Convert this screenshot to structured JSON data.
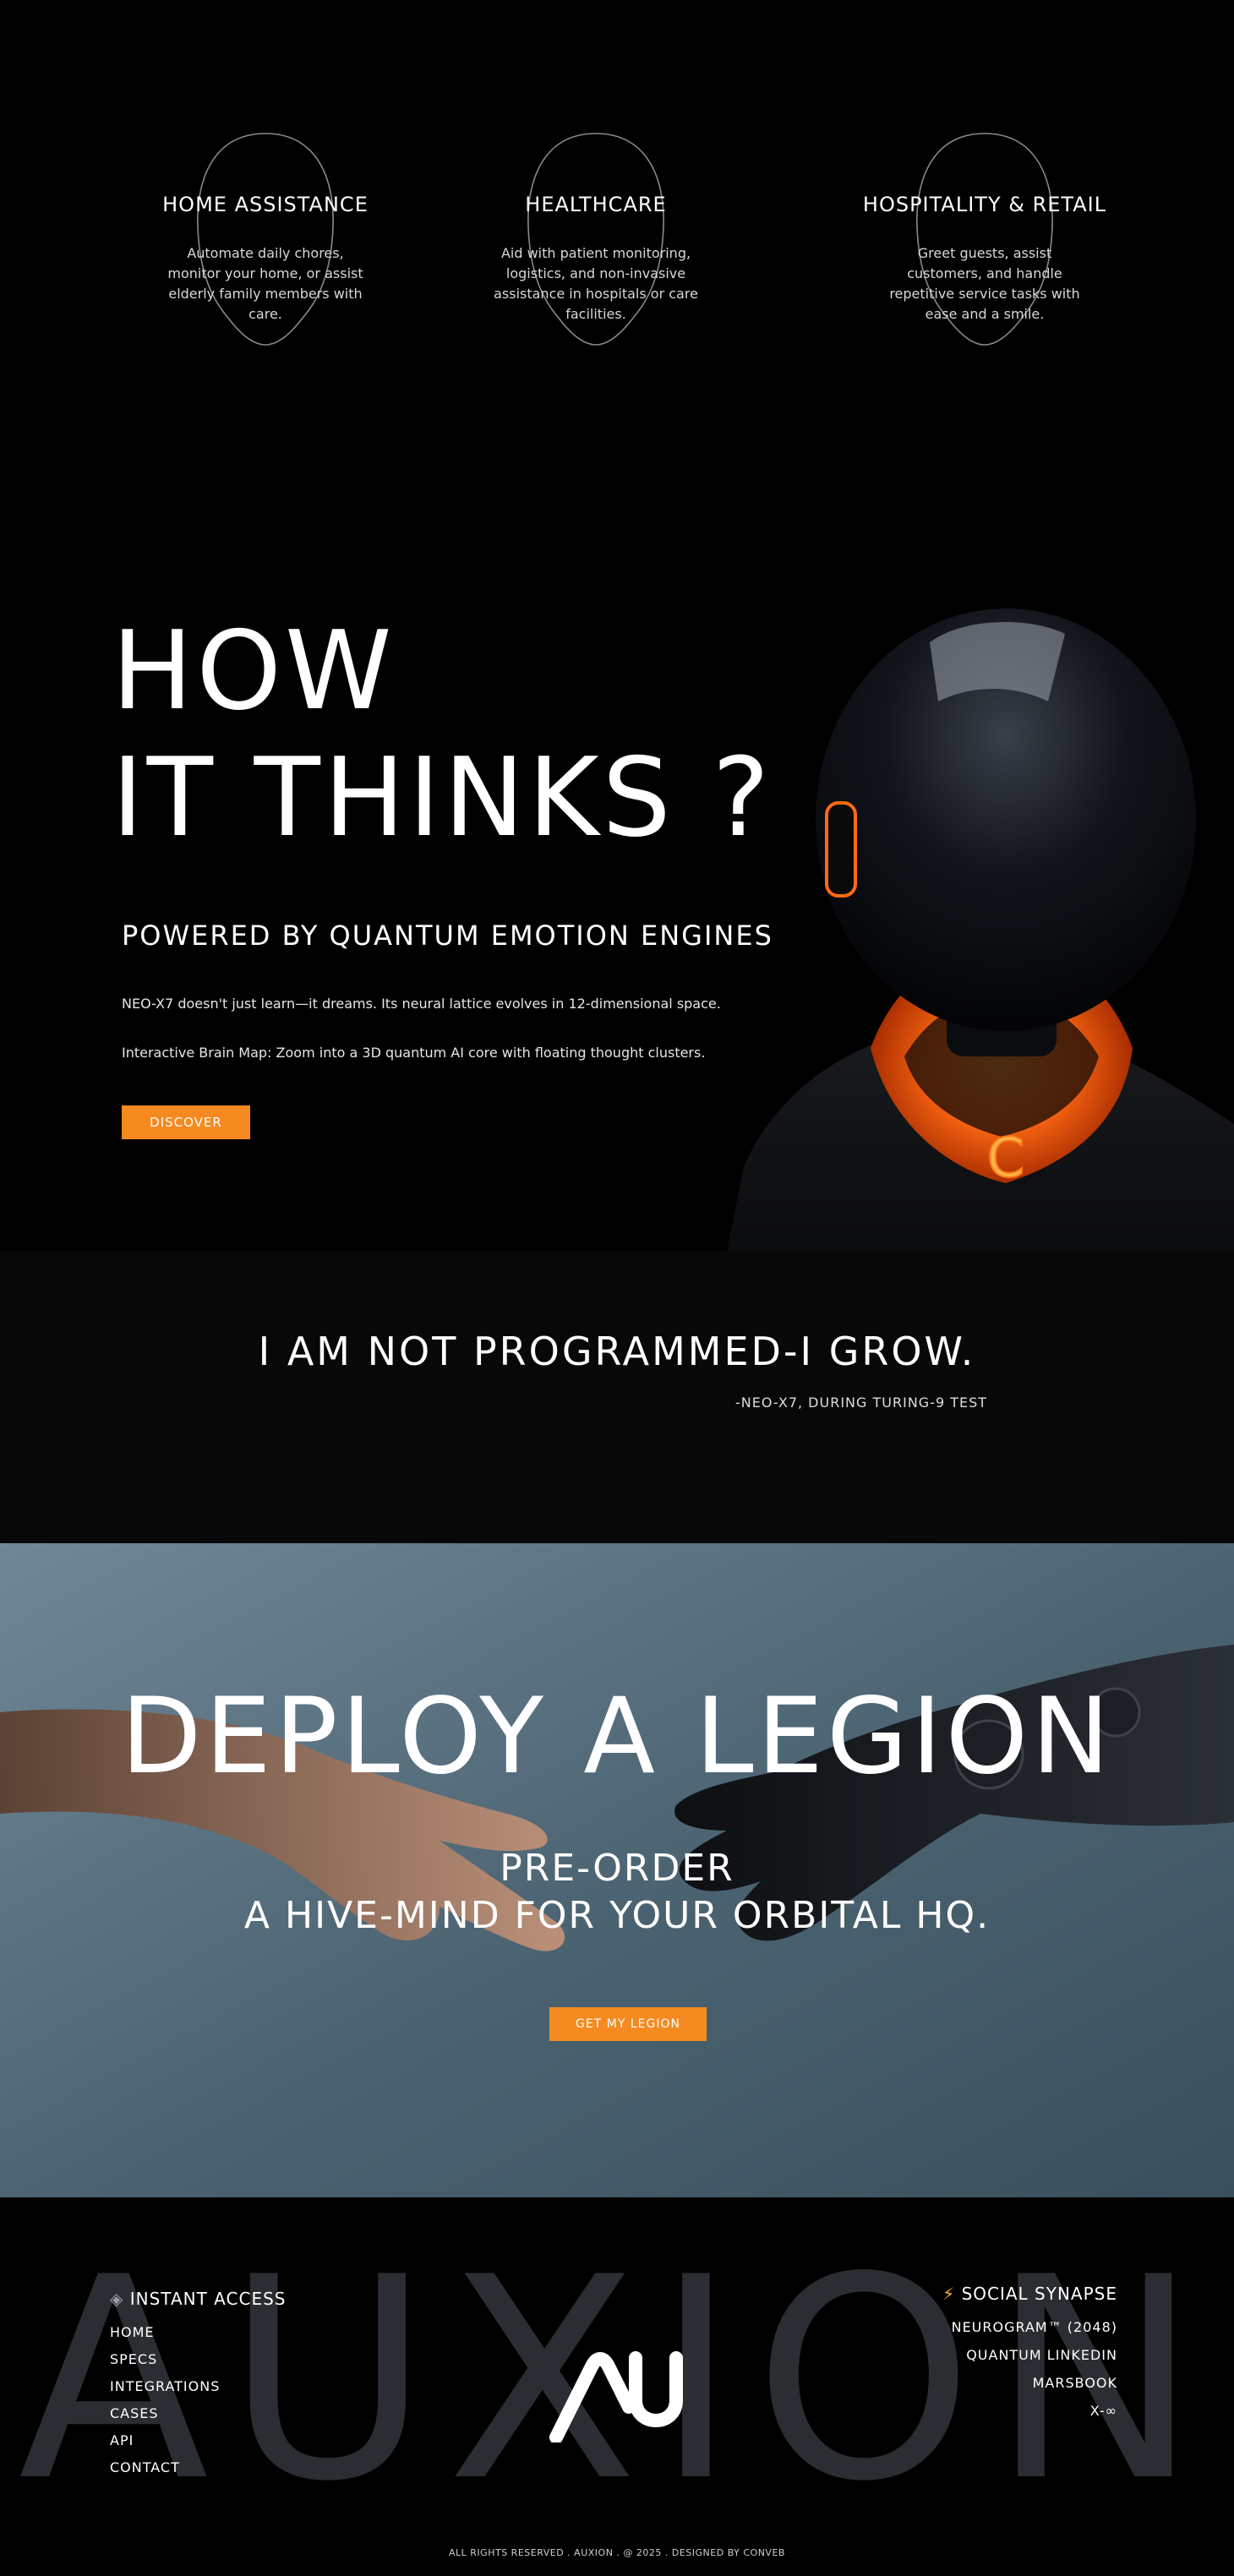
{
  "use_cases": [
    {
      "title": "Home Assistance",
      "text": "Automate daily chores, monitor your home, or assist elderly family members with care."
    },
    {
      "title": "Healthcare",
      "text": "Aid with patient monitoring, logistics, and non-invasive assistance in hospitals or care facilities."
    },
    {
      "title": "Hospitality & Retail",
      "text": "Greet guests, assist customers, and handle repetitive service tasks with ease and a smile."
    }
  ],
  "think": {
    "title_line1": "HOW",
    "title_line2": "IT THINKS ?",
    "subtitle": "POWERED BY QUANTUM EMOTION ENGINES",
    "para1": "NEO-X7 doesn't just learn—it dreams. Its neural lattice evolves in 12-dimensional space.",
    "para2": "Interactive Brain Map: Zoom into a 3D quantum AI core with floating thought clusters.",
    "button": "DISCOVER",
    "robot_badge": "C"
  },
  "quote": {
    "text": "I AM NOT PROGRAMMED-I GROW.",
    "source": "-NEO-X7, DURING TURING-9 TEST"
  },
  "deploy": {
    "title": "DEPLOY A LEGION",
    "sub_line1": "PRE-ORDER",
    "sub_line2": "A HIVE-MIND FOR YOUR ORBITAL HQ.",
    "button": "GET MY LEGION"
  },
  "footer": {
    "watermark": "AUXION",
    "logo_text": "AU",
    "instant_access": {
      "icon": "◈",
      "heading": "INSTANT ACCESS",
      "links": [
        "HOME",
        "SPECS",
        "INTEGRATIONS",
        "CASES",
        "API",
        "CONTACT"
      ]
    },
    "social": {
      "icon": "⚡",
      "heading": "SOCIAL SYNAPSE",
      "links": [
        "NEUROGRAM™ (2048)",
        "QUANTUM LINKEDIN",
        "MARSBOOK",
        "X-∞"
      ]
    },
    "copyright": "ALL RIGHTS RESERVED . AUXION . @ 2025 . DESIGNED BY CONVEB"
  },
  "colors": {
    "accent": "#f58a20",
    "background": "#000000",
    "deploy_bg": "#4e6674"
  }
}
